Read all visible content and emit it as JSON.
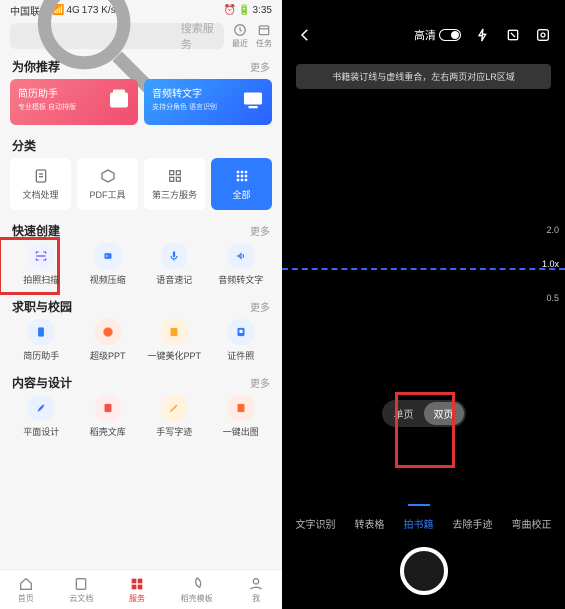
{
  "status": {
    "carrier": "中国联通",
    "signal": "4G",
    "speed": "173 K/s",
    "time": "3:35",
    "batt": "86"
  },
  "search": {
    "placeholder": "搜索服务"
  },
  "topIcons": {
    "recent": "最近",
    "tasks": "任务"
  },
  "sections": {
    "recommend": {
      "title": "为你推荐",
      "more": "更多"
    },
    "category": {
      "title": "分类"
    },
    "quick": {
      "title": "快速创建",
      "more": "更多"
    },
    "job": {
      "title": "求职与校园",
      "more": "更多"
    },
    "design": {
      "title": "内容与设计",
      "more": "更多"
    }
  },
  "promos": [
    {
      "title": "简历助手",
      "sub": "专业模板 自动排版"
    },
    {
      "title": "音频转文字",
      "sub": "支持分角色 语言识别"
    }
  ],
  "categories": [
    "文档处理",
    "PDF工具",
    "第三方服务",
    "全部"
  ],
  "quick": [
    "拍照扫描",
    "视频压缩",
    "语音速记",
    "音频转文字"
  ],
  "job": [
    "简历助手",
    "超级PPT",
    "一键美化PPT",
    "证件照"
  ],
  "design": [
    "平面设计",
    "稻壳文库",
    "手写字迹",
    "一键出图"
  ],
  "nav": [
    "首页",
    "云文档",
    "服务",
    "稻壳模板",
    "我"
  ],
  "camera": {
    "hd": "高清",
    "hint": "书籍装订线与虚线重合，左右两页对应LR区域",
    "zoom": [
      "2.0",
      "1.0x",
      "0.5"
    ],
    "pageModes": [
      "单页",
      "双页"
    ],
    "modes": [
      "文字识别",
      "转表格",
      "拍书籍",
      "去除手迹",
      "弯曲校正"
    ]
  }
}
